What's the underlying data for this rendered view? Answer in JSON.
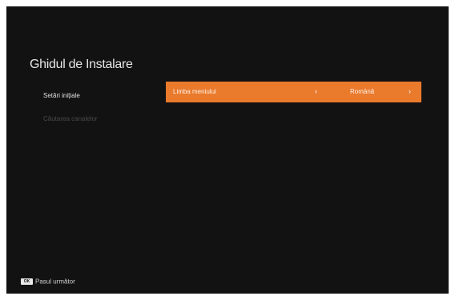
{
  "title": "Ghidul de Instalare",
  "sidebar": {
    "items": [
      {
        "label": "Setări inițiale"
      },
      {
        "label": "Căutarea canalelor"
      }
    ]
  },
  "setting": {
    "label": "Limba meniului",
    "value": "Română",
    "left_arrow": "‹",
    "right_arrow": "›"
  },
  "footer": {
    "key": "OK",
    "label": "Pasul următor"
  },
  "colors": {
    "background": "#121212",
    "highlight": "#ea7a2c"
  }
}
